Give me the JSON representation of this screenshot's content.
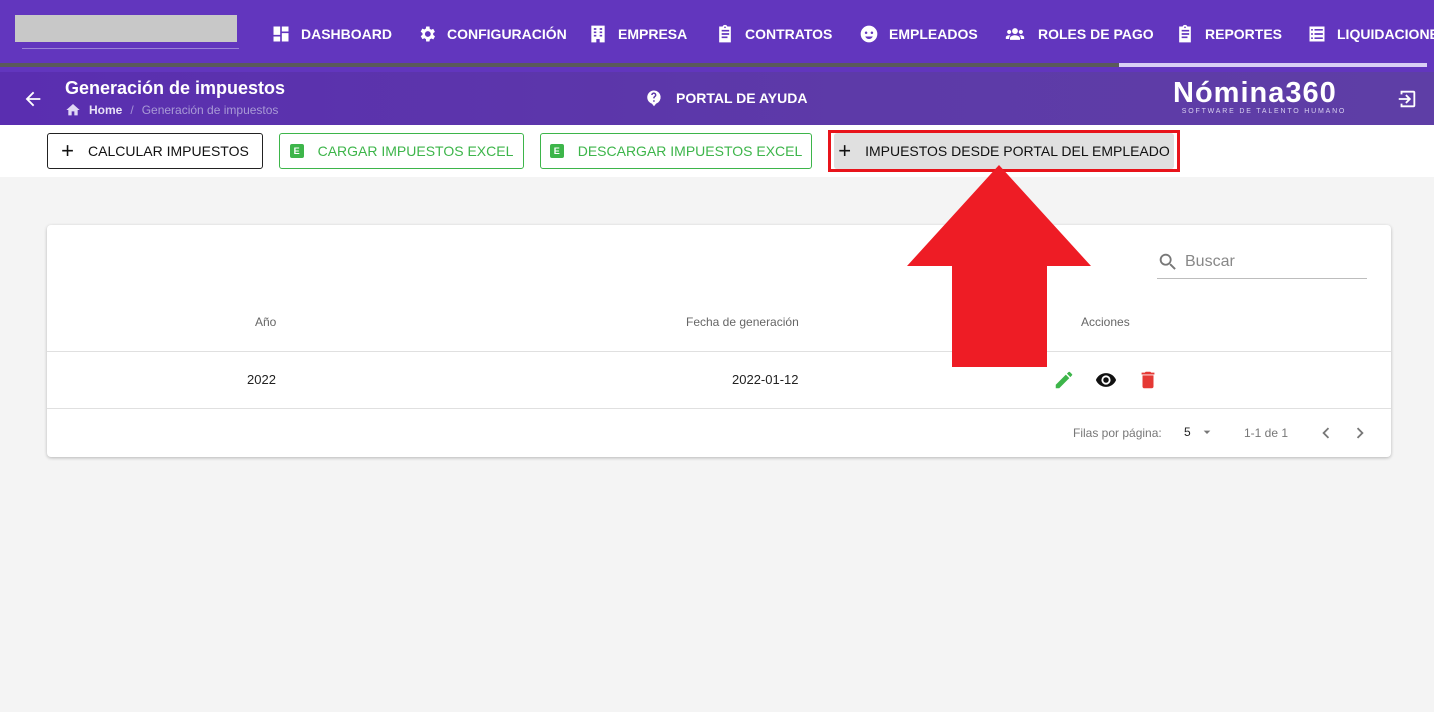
{
  "nav": {
    "items": [
      {
        "label": "DASHBOARD",
        "icon": "dashboard-icon"
      },
      {
        "label": "CONFIGURACIÓN",
        "icon": "gear-icon"
      },
      {
        "label": "EMPRESA",
        "icon": "building-icon"
      },
      {
        "label": "CONTRATOS",
        "icon": "clipboard-icon"
      },
      {
        "label": "EMPLEADOS",
        "icon": "face-icon"
      },
      {
        "label": "ROLES DE PAGO",
        "icon": "people-icon"
      },
      {
        "label": "REPORTES",
        "icon": "report-icon"
      },
      {
        "label": "LIQUIDACIONES",
        "icon": "list-icon"
      }
    ]
  },
  "header": {
    "title": "Generación de impuestos",
    "breadcrumb": {
      "home": "Home",
      "separator": "/",
      "current": "Generación de impuestos"
    },
    "help_label": "PORTAL DE AYUDA",
    "brand_name": "Nómina360",
    "brand_tagline": "SOFTWARE DE TALENTO HUMANO"
  },
  "toolbar": {
    "calc_label": "CALCULAR IMPUESTOS",
    "upload_label": "CARGAR IMPUESTOS EXCEL",
    "download_label": "DESCARGAR IMPUESTOS EXCEL",
    "portal_label": "IMPUESTOS DESDE PORTAL DEL EMPLEADO",
    "excel_badge": "E",
    "plus_glyph": "+"
  },
  "table": {
    "search_placeholder": "Buscar",
    "columns": [
      "Año",
      "Fecha de generación",
      "Acciones"
    ],
    "rows": [
      {
        "year": "2022",
        "date": "2022-01-12",
        "actions": [
          "edit-icon",
          "view-icon",
          "delete-icon"
        ]
      }
    ],
    "footer": {
      "rows_per_page_label": "Filas por página:",
      "rows_per_page": "5",
      "range": "1-1 de 1"
    }
  },
  "colors": {
    "nav_bg": "#6236be",
    "subheader_bg": "#5a2eb0",
    "accent_green": "#3db54a",
    "highlight_red": "#e8141b",
    "delete_red": "#e53935"
  }
}
